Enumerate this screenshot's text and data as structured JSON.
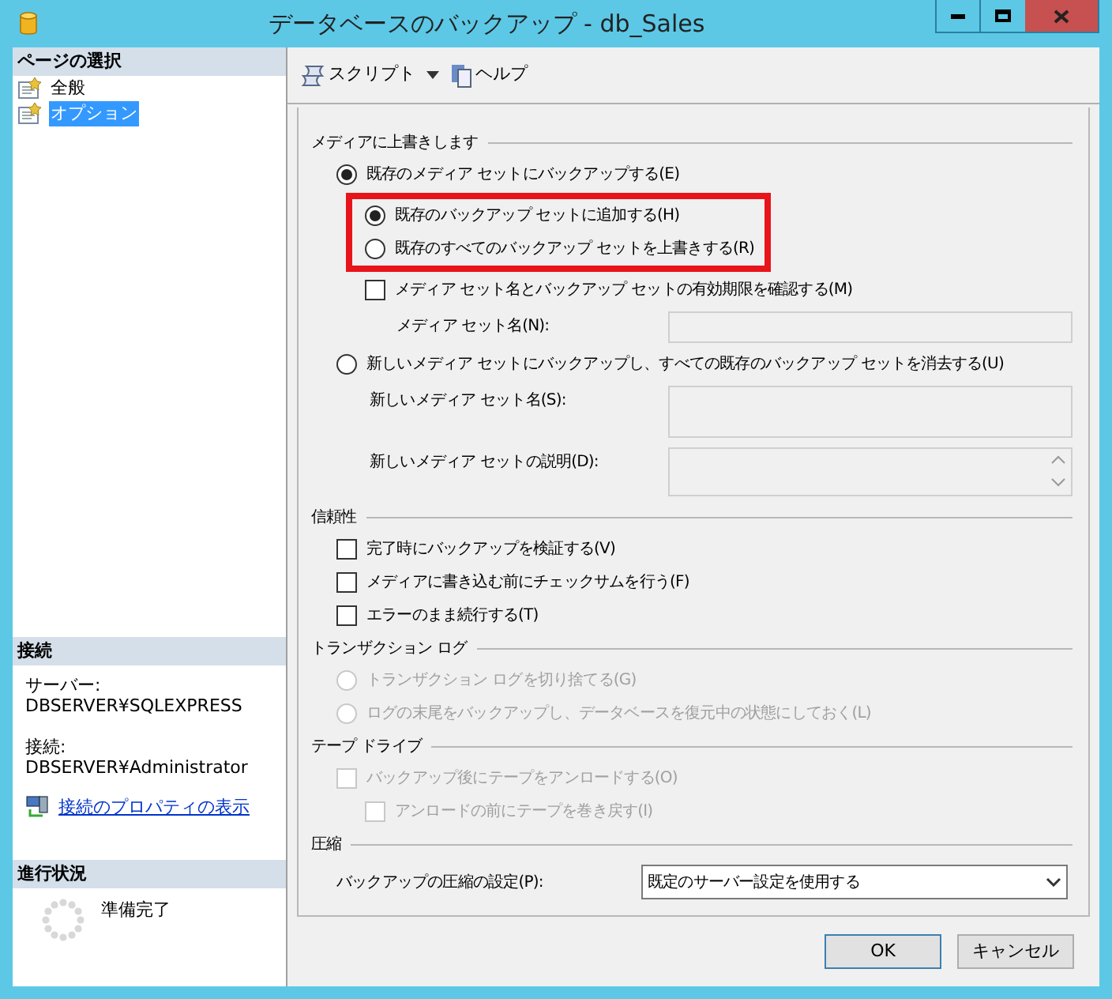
{
  "window": {
    "title": "データベースのバックアップ - db_Sales"
  },
  "sidebar": {
    "header": "ページの選択",
    "pages": [
      {
        "label": "全般",
        "selected": false
      },
      {
        "label": "オプション",
        "selected": true
      }
    ]
  },
  "connection": {
    "header": "接続",
    "server_label": "サーバー:",
    "server": "DBSERVER¥SQLEXPRESS",
    "connection_label": "接続:",
    "connection": "DBSERVER¥Administrator",
    "link": "接続のプロパティの表示"
  },
  "progress": {
    "header": "進行状況",
    "status": "準備完了"
  },
  "toolbar": {
    "script": "スクリプト",
    "help": "ヘルプ"
  },
  "sections": [
    {
      "title": "メディアに上書きします",
      "items": [
        {
          "kind": "radio",
          "label": "既存のメディア セットにバックアップする(E)",
          "selected": true,
          "disabled": false,
          "children": [
            {
              "kind": "group",
              "outlined": true,
              "children": [
                {
                  "kind": "radio",
                  "label": "既存のバックアップ セットに追加する(H)",
                  "selected": true,
                  "disabled": false
                },
                {
                  "kind": "radio",
                  "label": "既存のすべてのバックアップ セットを上書きする(R)",
                  "selected": false,
                  "disabled": false
                }
              ]
            },
            {
              "kind": "checkbox",
              "label": "メディア セット名とバックアップ セットの有効期限を確認する(M)",
              "checked": false,
              "disabled": false
            },
            {
              "kind": "text_field",
              "label": "メディア セット名(N):",
              "disabled": true
            }
          ]
        },
        {
          "kind": "radio",
          "label": "新しいメディア セットにバックアップし、すべての既存のバックアップ セットを消去する(U)",
          "selected": false,
          "disabled": false,
          "children": [
            {
              "kind": "text_box",
              "label": "新しいメディア セット名(S):",
              "disabled": true
            },
            {
              "kind": "text_area",
              "label": "新しいメディア セットの説明(D):",
              "disabled": true
            }
          ]
        }
      ]
    },
    {
      "title": "信頼性",
      "items": [
        {
          "kind": "checkbox",
          "label": "完了時にバックアップを検証する(V)",
          "checked": false,
          "disabled": false
        },
        {
          "kind": "checkbox",
          "label": "メディアに書き込む前にチェックサムを行う(F)",
          "checked": false,
          "disabled": false
        },
        {
          "kind": "checkbox",
          "label": "エラーのまま続行する(T)",
          "checked": false,
          "disabled": false
        }
      ]
    },
    {
      "title": "トランザクション ログ",
      "items": [
        {
          "kind": "radio",
          "label": "トランザクション ログを切り捨てる(G)",
          "selected": false,
          "disabled": true
        },
        {
          "kind": "radio",
          "label": "ログの末尾をバックアップし、データベースを復元中の状態にしておく(L)",
          "selected": false,
          "disabled": true
        }
      ]
    },
    {
      "title": "テープ ドライブ",
      "items": [
        {
          "kind": "checkbox",
          "label": "バックアップ後にテープをアンロードする(O)",
          "checked": false,
          "disabled": true,
          "children": [
            {
              "kind": "checkbox",
              "label": "アンロードの前にテープを巻き戻す(I)",
              "checked": false,
              "disabled": true
            }
          ]
        }
      ]
    },
    {
      "title": "圧縮",
      "items": [
        {
          "kind": "select",
          "label": "バックアップの圧縮の設定(P):",
          "value": "既定のサーバー設定を使用する"
        }
      ]
    }
  ],
  "buttons": [
    "OK",
    "キャンセル"
  ]
}
